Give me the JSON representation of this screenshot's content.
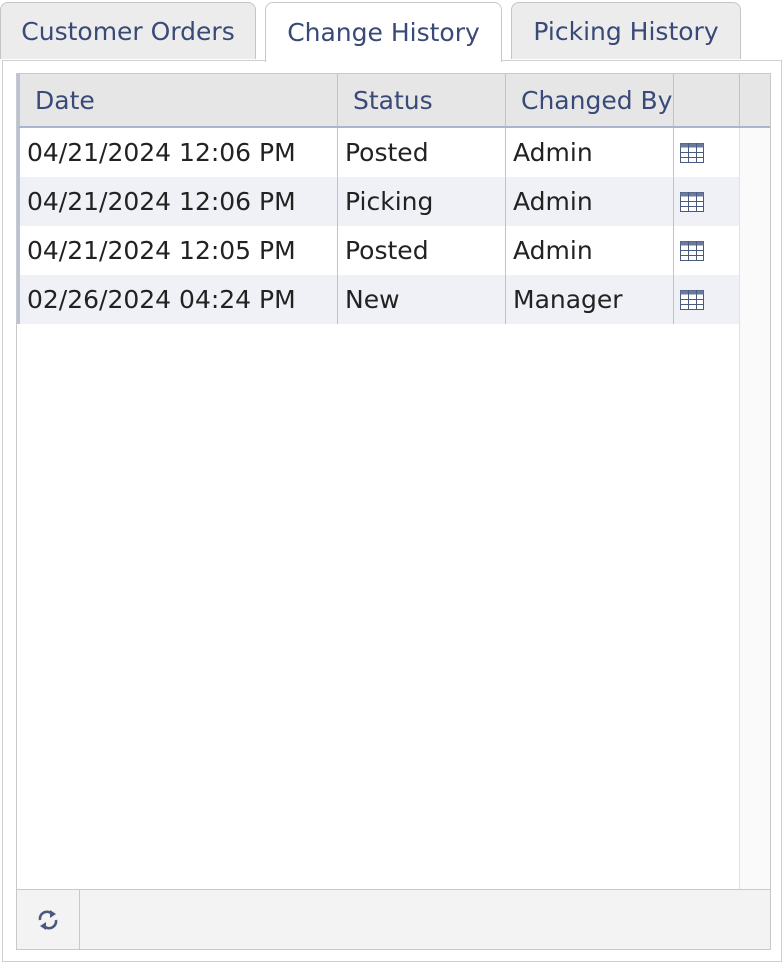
{
  "tabs": [
    {
      "label": "Customer Orders",
      "active": false
    },
    {
      "label": "Change History",
      "active": true
    },
    {
      "label": "Picking History",
      "active": false
    }
  ],
  "grid": {
    "columns": [
      "Date",
      "Status",
      "Changed By",
      ""
    ],
    "rows": [
      {
        "date": "04/21/2024 12:06 PM",
        "status": "Posted",
        "changed_by": "Admin",
        "icon": "table-grid-icon"
      },
      {
        "date": "04/21/2024 12:06 PM",
        "status": "Picking",
        "changed_by": "Admin",
        "icon": "table-grid-icon"
      },
      {
        "date": "04/21/2024 12:05 PM",
        "status": "Posted",
        "changed_by": "Admin",
        "icon": "table-grid-icon"
      },
      {
        "date": "02/26/2024 04:24 PM",
        "status": "New",
        "changed_by": "Manager",
        "icon": "table-grid-icon"
      }
    ]
  },
  "footer": {
    "refresh_icon": "refresh-icon"
  },
  "colors": {
    "accent_text": "#3a4a78",
    "header_bg": "#e6e6e6",
    "alt_row_bg": "#eff1f6",
    "icon": "#4a5a7e"
  }
}
